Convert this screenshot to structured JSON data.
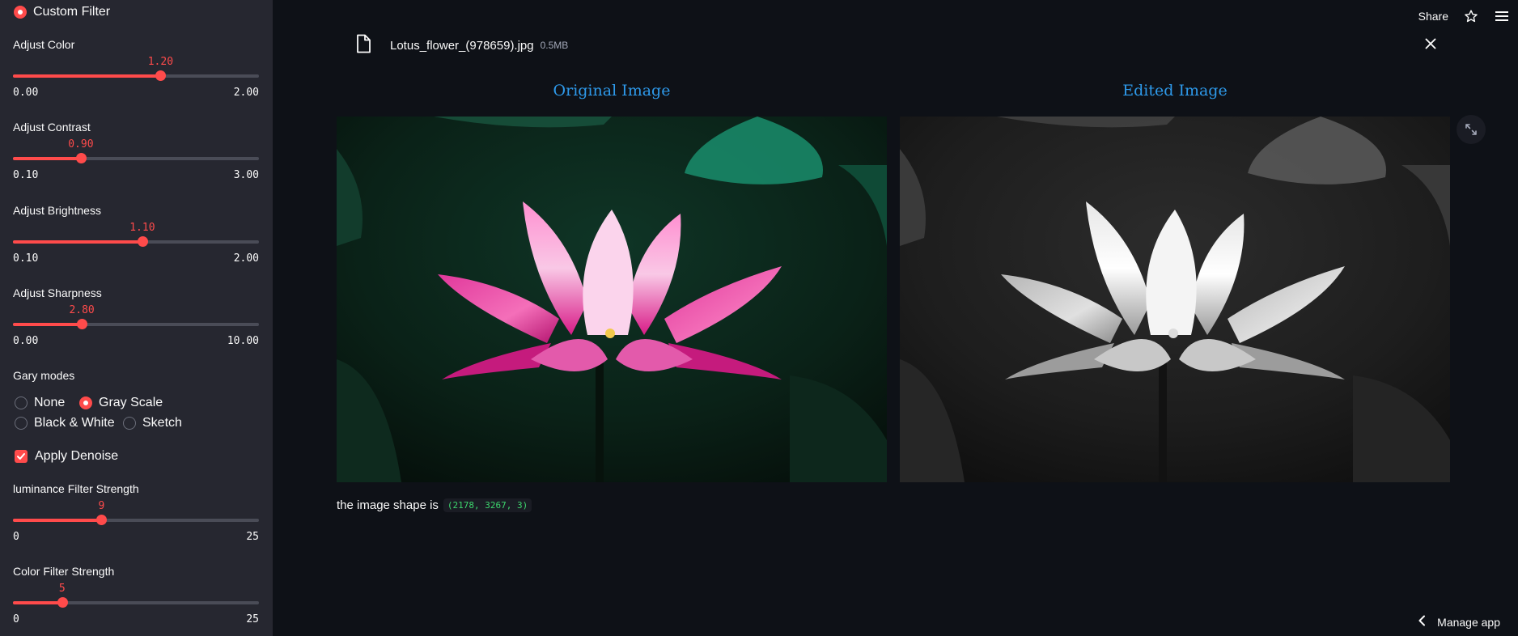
{
  "sidebar": {
    "filter_radio_label": "Custom Filter",
    "sliders": [
      {
        "label": "Adjust Color",
        "value": "1.20",
        "min": "0.00",
        "max": "2.00",
        "fraction": 0.6
      },
      {
        "label": "Adjust Contrast",
        "value": "0.90",
        "min": "0.10",
        "max": "3.00",
        "fraction": 0.276
      },
      {
        "label": "Adjust Brightness",
        "value": "1.10",
        "min": "0.10",
        "max": "2.00",
        "fraction": 0.526
      },
      {
        "label": "Adjust Sharpness",
        "value": "2.80",
        "min": "0.00",
        "max": "10.00",
        "fraction": 0.28
      },
      {
        "label": "luminance Filter Strength",
        "value": "9",
        "min": "0",
        "max": "25",
        "fraction": 0.36
      },
      {
        "label": "Color Filter Strength",
        "value": "5",
        "min": "0",
        "max": "25",
        "fraction": 0.2
      }
    ],
    "gray_modes": {
      "label": "Gary modes",
      "options": [
        "None",
        "Gray Scale",
        "Black & White",
        "Sketch"
      ],
      "selected": "Gray Scale"
    },
    "denoise_label": "Apply Denoise",
    "denoise_checked": true
  },
  "header": {
    "share_label": "Share"
  },
  "file": {
    "name": "Lotus_flower_(978659).jpg",
    "size": "0.5MB"
  },
  "main": {
    "original_title": "Original Image",
    "edited_title": "Edited Image",
    "shape_text": "the image shape is",
    "shape_code": "(2178, 3267, 3)"
  },
  "footer": {
    "manage_label": "Manage app"
  },
  "colors": {
    "accent": "#ff4b4b",
    "title_blue": "#2e9aeb",
    "code_green": "#3dd56d",
    "sidebar_bg": "#262730",
    "main_bg": "#0e1117"
  }
}
